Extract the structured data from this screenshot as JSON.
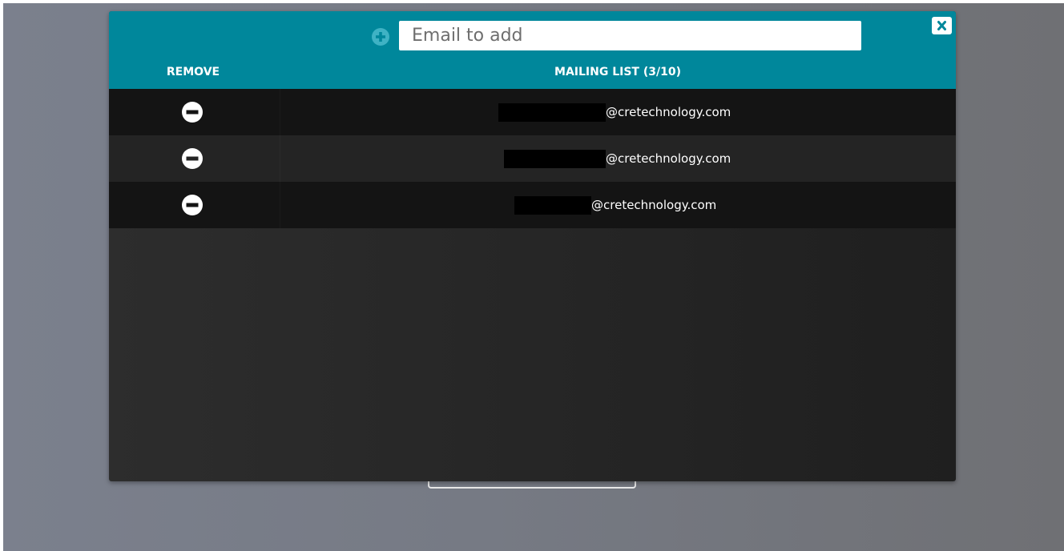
{
  "header": {
    "email_placeholder": "Email to add",
    "add_icon": "plus-circle-icon",
    "close_icon": "close-icon"
  },
  "columns": {
    "remove": "REMOVE",
    "mailing_list": "MAILING LIST (3/10)"
  },
  "rows": [
    {
      "domain": "@cretechnology.com",
      "remove_icon": "minus-circle-icon"
    },
    {
      "domain": "@cretechnology.com",
      "remove_icon": "minus-circle-icon"
    },
    {
      "domain": "@cretechnology.com",
      "remove_icon": "minus-circle-icon"
    }
  ],
  "colors": {
    "header_teal": "#00879b",
    "modal_dark": "#262626"
  }
}
